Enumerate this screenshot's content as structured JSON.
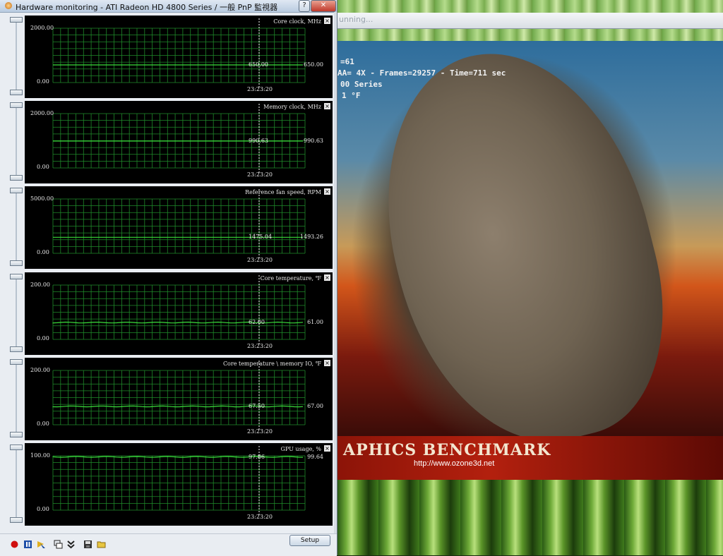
{
  "window": {
    "title": "Hardware monitoring - ATI Radeon HD 4800 Series  / 一般 PnP 監視器",
    "help_label": "?",
    "close_label": "✕"
  },
  "graphs": [
    {
      "title": "Core clock, MHz",
      "max": "2000.00",
      "min": "0.00",
      "cursor_value": "650.00",
      "current_value": "650.00",
      "time": "23:23:20",
      "level": 0.325
    },
    {
      "title": "Memory clock, MHz",
      "max": "2000.00",
      "min": "0.00",
      "cursor_value": "990.63",
      "current_value": "990.63",
      "time": "23:23:20",
      "level": 0.495
    },
    {
      "title": "Reference fan speed, RPM",
      "max": "5000.00",
      "min": "0.00",
      "cursor_value": "1475.04",
      "current_value": "1493.26",
      "time": "23:23:20",
      "level": 0.295
    },
    {
      "title": "Core temperature, ℉",
      "max": "200.00",
      "min": "0.00",
      "cursor_value": "62.00",
      "current_value": "61.00",
      "time": "23:23:20",
      "level": 0.31
    },
    {
      "title": "Core temperature \\ memory IO, ℉",
      "max": "200.00",
      "min": "0.00",
      "cursor_value": "67.50",
      "current_value": "67.00",
      "time": "23:23:20",
      "level": 0.3375
    },
    {
      "title": "GPU usage, %",
      "max": "100.00",
      "min": "0.00",
      "cursor_value": "97.86",
      "current_value": "99.64",
      "time": "23:23:20",
      "level": 0.98
    }
  ],
  "toolbar": {
    "setup_label": "Setup",
    "icons": [
      "record-icon",
      "pause-icon",
      "marker-icon",
      "copy-icon",
      "expand-icon",
      "save-icon",
      "open-folder-icon"
    ]
  },
  "background_app": {
    "titlebar_text": "unning...",
    "overlay": [
      "=61",
      "AA= 4X - Frames=29257 - Time=711 sec",
      "00 Series",
      "1 °F"
    ],
    "banner_title": "APHICS BENCHMARK",
    "banner_url": "http://www.ozone3d.net"
  },
  "colors": {
    "grid": "#1f8a2a",
    "trace": "#3adc3a",
    "panel_bg": "#000000",
    "banner": "#b3200e"
  }
}
